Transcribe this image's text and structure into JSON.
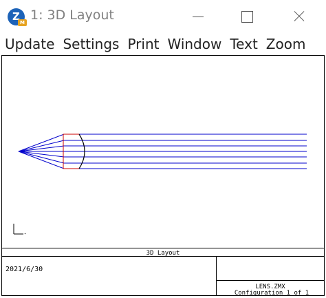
{
  "window": {
    "title": "1: 3D Layout",
    "app_icon_letter": "Z",
    "app_icon_badge": "M"
  },
  "menu": {
    "items": [
      "Update",
      "Settings",
      "Print",
      "Window",
      "Text",
      "Zoom"
    ]
  },
  "plot": {
    "rays_color": "#0000cc",
    "lens_edge_color": "#cc0000",
    "lens_color": "#000000"
  },
  "title_block": {
    "title": "3D Layout",
    "date": "2021/6/30",
    "file": "LENS.ZMX",
    "configuration": "Configuration 1 of 1"
  }
}
